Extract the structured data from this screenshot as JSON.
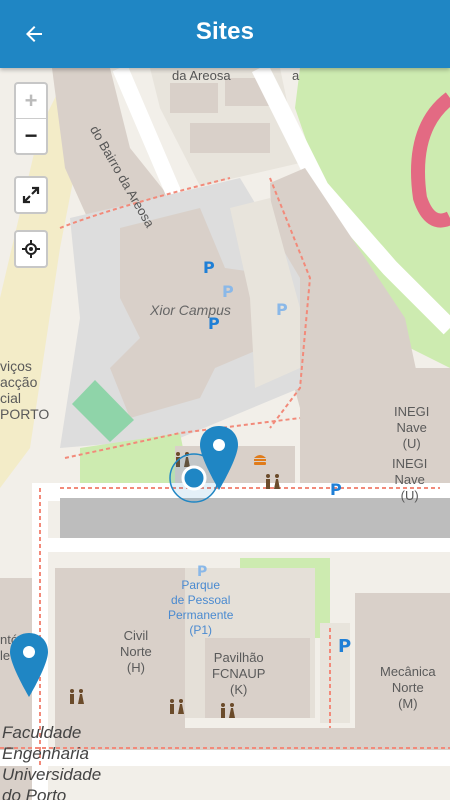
{
  "app_bar": {
    "title": "Sites",
    "back_icon": "arrow-left-icon",
    "color": "#1f86c4"
  },
  "map": {
    "controls": {
      "zoom_in": "+",
      "zoom_out": "−",
      "fullscreen_icon": "expand-icon",
      "locate_icon": "crosshair-icon",
      "zoom_in_enabled": false
    },
    "roads": {
      "bairro": "do Bairro da Areosa",
      "areosa_top": "da Areosa",
      "corner_top": "a"
    },
    "labels": {
      "xior": "Xior Campus",
      "inegi1": "INEGI\nNave\n(U)",
      "inegi2": "INEGI\nNave\n(U)",
      "parque": "Parque\nde Pessoal\nPermanente\n(P1)",
      "civil": "Civil\nNorte\n(H)",
      "pavilhao": "Pavilhão\nFCNAUP\n(K)",
      "mecanica": "Mecânica\nNorte\n(M)",
      "servicos": "viços\nacção\ncial\nPORTO",
      "left_frag": "ntó\nle",
      "feup": "Faculdade\nEngenharia\nUniversidade\ndo Porto"
    },
    "markers": [
      {
        "name": "site-marker-inegi",
        "color": "#1f86c4"
      },
      {
        "name": "site-marker-civil",
        "color": "#1f86c4"
      }
    ],
    "user_location_color": "#1f86c4"
  }
}
